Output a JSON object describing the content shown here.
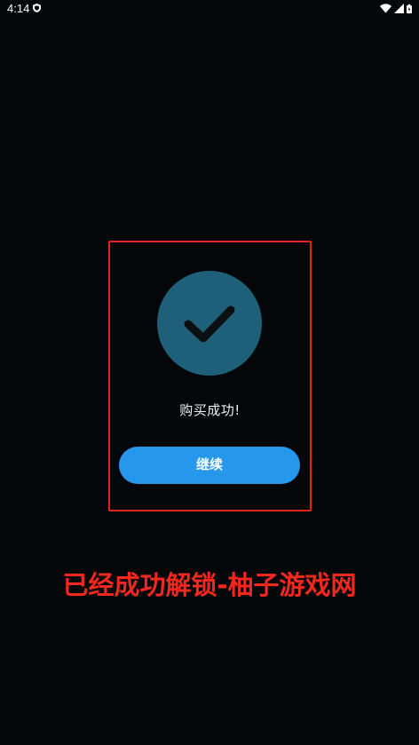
{
  "status_bar": {
    "time": "4:14",
    "icons": [
      "shield-icon",
      "wifi-icon",
      "signal-icon",
      "battery-icon"
    ]
  },
  "dialog": {
    "icon": "checkmark-icon",
    "message": "购买成功!",
    "button_label": "继续"
  },
  "overlay": {
    "caption": "已经成功解锁-柚子游戏网"
  },
  "colors": {
    "background": "#03070a",
    "check_circle": "#1e6079",
    "button": "#2797ec",
    "highlight_border": "#e4211f",
    "caption": "#f2281f"
  }
}
